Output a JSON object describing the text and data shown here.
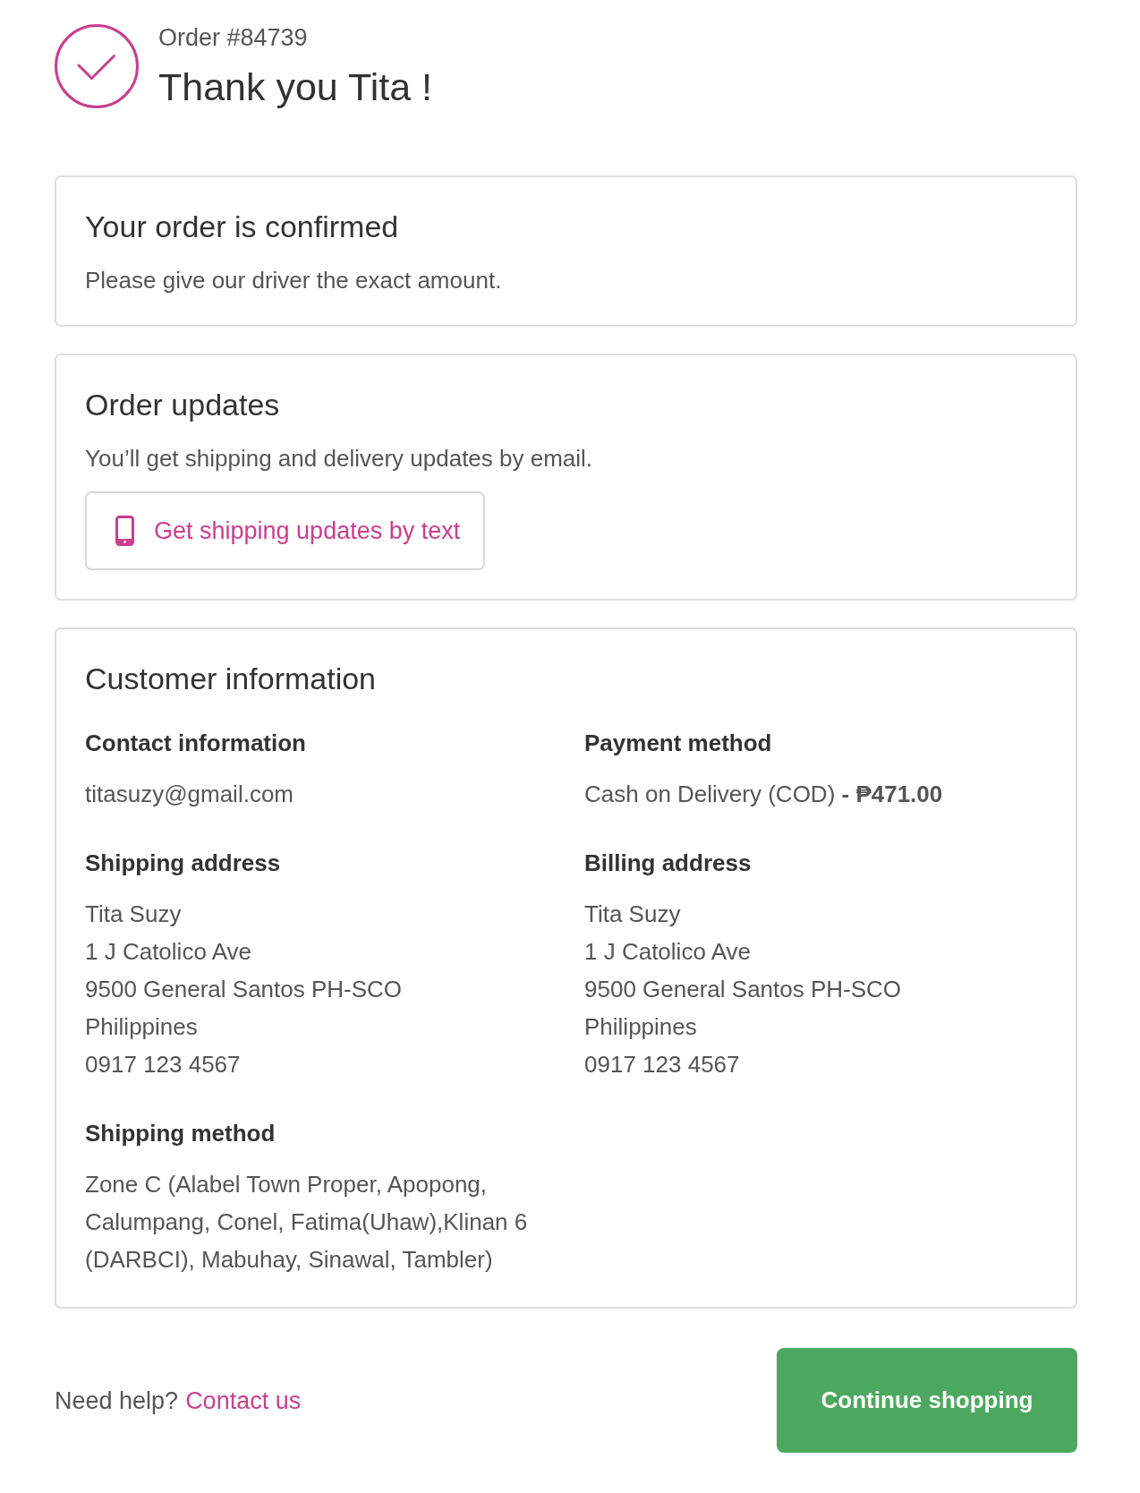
{
  "header": {
    "order_number": "Order #84739",
    "title": "Thank you Tita !"
  },
  "confirmation": {
    "title": "Your order is confirmed",
    "message": "Please give our driver the exact amount."
  },
  "order_updates": {
    "title": "Order updates",
    "message": "You’ll get shipping and delivery updates by email.",
    "button": "Get shipping updates by text"
  },
  "customer_information": {
    "title": "Customer information",
    "columns": [
      {
        "sections": [
          {
            "heading": "Contact information",
            "lines": [
              "titasuzy@gmail.com"
            ]
          },
          {
            "heading": "Shipping address",
            "lines": [
              "Tita Suzy",
              "1 J Catolico Ave",
              "9500 General Santos PH-SCO",
              "Philippines",
              "0917 123 4567"
            ]
          },
          {
            "heading": "Shipping method",
            "lines": [
              "Zone C (Alabel Town Proper, Apopong, Calumpang, Conel, Fatima(Uhaw),Klinan 6 (DARBCI), Mabuhay, Sinawal, Tambler)"
            ]
          }
        ]
      },
      {
        "sections": [
          {
            "heading": "Payment method",
            "lines": [
              "Cash on Delivery (COD) **- ₱471.00**"
            ]
          },
          {
            "heading": "Billing address",
            "lines": [
              "Tita Suzy",
              "1 J Catolico Ave",
              "9500 General Santos PH-SCO",
              "Philippines",
              "0917 123 4567"
            ]
          }
        ]
      }
    ]
  },
  "footer": {
    "help_text": "Need help?",
    "help_link": "Contact us",
    "continue_button": "Continue shopping"
  }
}
